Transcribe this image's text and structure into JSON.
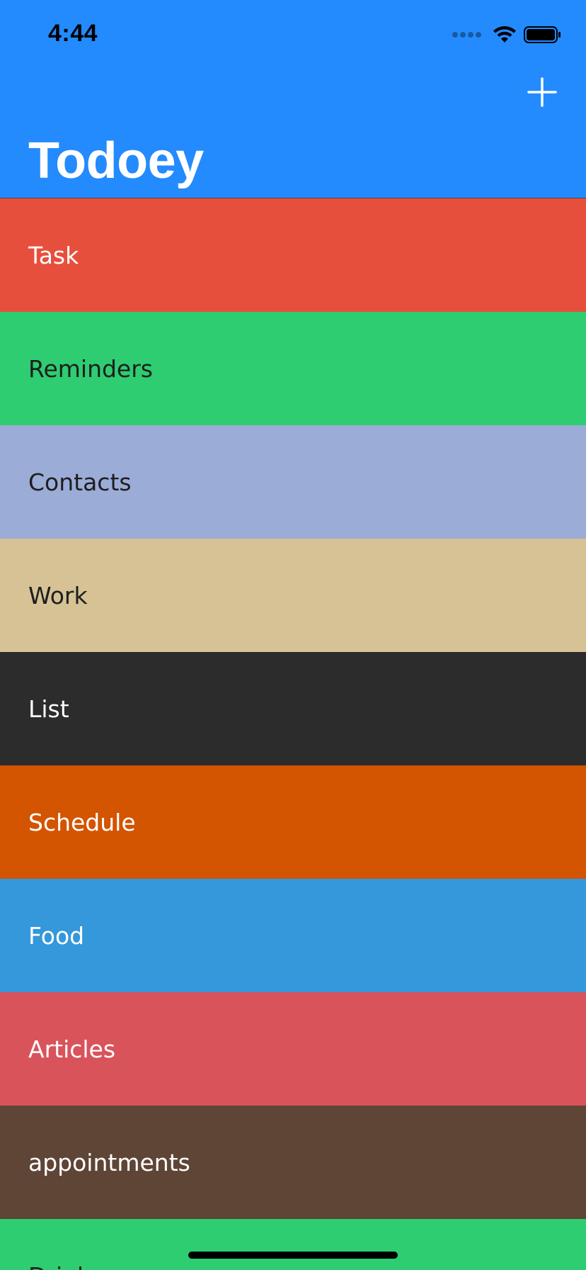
{
  "status_bar": {
    "time": "4:44"
  },
  "nav": {
    "title": "Todoey",
    "add_icon": "plus-icon"
  },
  "categories": [
    {
      "name": "Task",
      "color": "#E74F3D",
      "text_color": "#FFFFFF"
    },
    {
      "name": "Reminders",
      "color": "#2ECD71",
      "text_color": "#1E1E1E"
    },
    {
      "name": "Contacts",
      "color": "#9BACD7",
      "text_color": "#1E1E1E"
    },
    {
      "name": "Work",
      "color": "#D6C295",
      "text_color": "#1E1E1E"
    },
    {
      "name": "List",
      "color": "#2C2C2C",
      "text_color": "#FFFFFF"
    },
    {
      "name": "Schedule",
      "color": "#D35401",
      "text_color": "#FFFFFF"
    },
    {
      "name": "Food",
      "color": "#3498DB",
      "text_color": "#FFFFFF"
    },
    {
      "name": "Articles",
      "color": "#D9535B",
      "text_color": "#FFFFFF"
    },
    {
      "name": "appointments",
      "color": "#5E4535",
      "text_color": "#FFFFFF"
    },
    {
      "name": "Drinks",
      "color": "#2ECD71",
      "text_color": "#1E1E1E"
    }
  ],
  "colors": {
    "nav_background": "#238BFD"
  }
}
